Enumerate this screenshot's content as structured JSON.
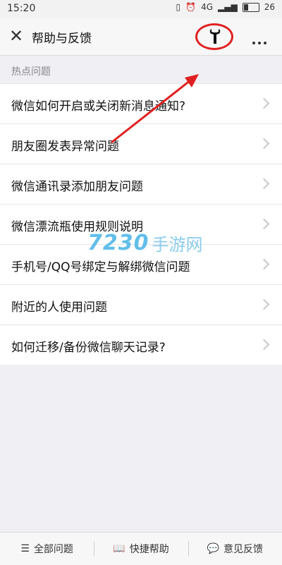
{
  "status": {
    "time": "15:20",
    "network": "4G",
    "battery": "26"
  },
  "header": {
    "title": "帮助与反馈",
    "close_icon": "close-icon",
    "tool_icon": "wrench-icon",
    "more_icon": "more-icon"
  },
  "section": {
    "title": "热点问题"
  },
  "list": [
    {
      "label": "微信如何开启或关闭新消息通知?"
    },
    {
      "label": "朋友圈发表异常问题"
    },
    {
      "label": "微信通讯录添加朋友问题"
    },
    {
      "label": "微信漂流瓶使用规则说明"
    },
    {
      "label": "手机号/QQ号绑定与解绑微信问题"
    },
    {
      "label": "附近的人使用问题"
    },
    {
      "label": "如何迁移/备份微信聊天记录?"
    }
  ],
  "watermark": {
    "number": "7230",
    "text": "手游网"
  },
  "bottom_tabs": [
    {
      "label": "全部问题",
      "icon": "list-icon"
    },
    {
      "label": "快捷帮助",
      "icon": "book-icon"
    },
    {
      "label": "意见反馈",
      "icon": "comment-icon"
    }
  ],
  "colors": {
    "highlight": "#e02020",
    "watermark": "#52b8e8"
  }
}
